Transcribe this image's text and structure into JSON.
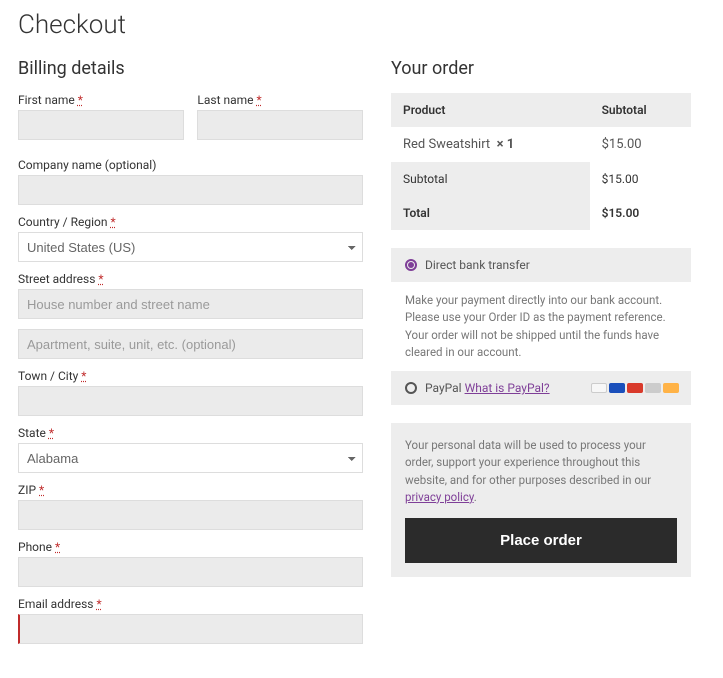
{
  "page_title": "Checkout",
  "billing": {
    "heading": "Billing details",
    "first_name_label": "First name",
    "last_name_label": "Last name",
    "company_label": "Company name (optional)",
    "country_label": "Country / Region",
    "country_value": "United States (US)",
    "street_label": "Street address",
    "street_placeholder": "House number and street name",
    "apt_placeholder": "Apartment, suite, unit, etc. (optional)",
    "town_label": "Town / City",
    "state_label": "State",
    "state_value": "Alabama",
    "zip_label": "ZIP",
    "phone_label": "Phone",
    "email_label": "Email address"
  },
  "order": {
    "heading": "Your order",
    "col_product": "Product",
    "col_subtotal": "Subtotal",
    "item_name": "Red Sweatshirt",
    "item_qty": "× 1",
    "item_price": "$15.00",
    "subtotal_label": "Subtotal",
    "subtotal_value": "$15.00",
    "total_label": "Total",
    "total_value": "$15.00"
  },
  "payment": {
    "bank_label": "Direct bank transfer",
    "bank_desc": "Make your payment directly into our bank account. Please use your Order ID as the payment reference. Your order will not be shipped until the funds have cleared in our account.",
    "paypal_label": "PayPal",
    "paypal_help": "What is PayPal?"
  },
  "privacy": {
    "text": "Your personal data will be used to process your order, support your experience throughout this website, and for other purposes described in our ",
    "link": "privacy policy"
  },
  "place_order_label": "Place order"
}
